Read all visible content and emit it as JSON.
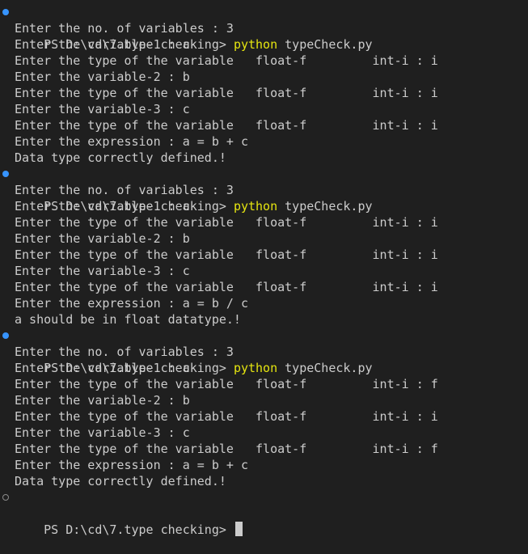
{
  "terminal": {
    "sessions": [
      {
        "prompt": "PS D:\\cd\\7.type checking> ",
        "command": "python",
        "args": " typeCheck.py",
        "output": [
          "Enter the no. of variables : 3",
          "Enter the variable-1 : a",
          "Enter the type of the variable   float-f         int-i : i",
          "Enter the variable-2 : b",
          "Enter the type of the variable   float-f         int-i : i",
          "Enter the variable-3 : c",
          "Enter the type of the variable   float-f         int-i : i",
          "Enter the expression : a = b + c",
          "Data type correctly defined.!"
        ]
      },
      {
        "prompt": "PS D:\\cd\\7.type checking> ",
        "command": "python",
        "args": " typeCheck.py",
        "output": [
          "Enter the no. of variables : 3",
          "Enter the variable-1 : a",
          "Enter the type of the variable   float-f         int-i : i",
          "Enter the variable-2 : b",
          "Enter the type of the variable   float-f         int-i : i",
          "Enter the variable-3 : c",
          "Enter the type of the variable   float-f         int-i : i",
          "Enter the expression : a = b / c",
          "a should be in float datatype.!"
        ]
      },
      {
        "prompt": "PS D:\\cd\\7.type checking> ",
        "command": "python",
        "args": " typeCheck.py",
        "output": [
          "Enter the no. of variables : 3",
          "Enter the variable-1 : a",
          "Enter the type of the variable   float-f         int-i : f",
          "Enter the variable-2 : b",
          "Enter the type of the variable   float-f         int-i : i",
          "Enter the variable-3 : c",
          "Enter the type of the variable   float-f         int-i : f",
          "Enter the expression : a = b + c",
          "Data type correctly defined.!"
        ]
      }
    ],
    "final_prompt": "PS D:\\cd\\7.type checking> ",
    "colors": {
      "background": "#1f1f1f",
      "text": "#cccccc",
      "command": "#e5e510",
      "decoration_success": "#3794ff",
      "decoration_pending": "#8b8b8b"
    }
  }
}
